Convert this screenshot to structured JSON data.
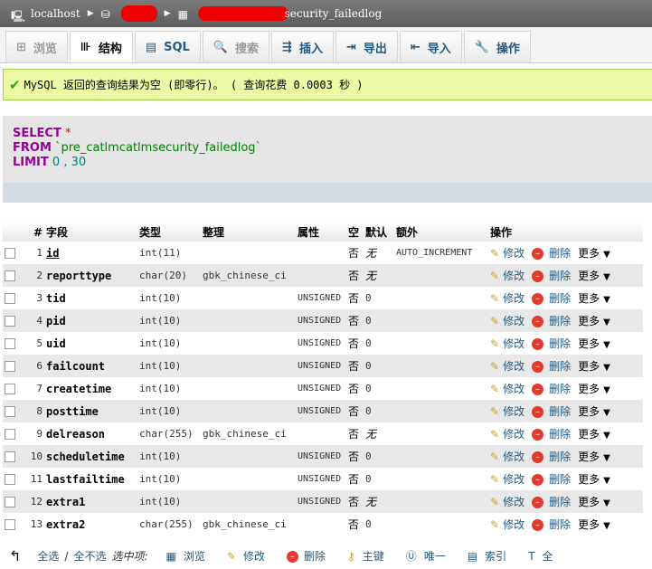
{
  "breadcrumb": {
    "server": "localhost",
    "table": "security_failedlog"
  },
  "tabs": [
    {
      "label": "浏览",
      "icon": "⊞"
    },
    {
      "label": "结构",
      "icon": "⊪"
    },
    {
      "label": "SQL",
      "icon": "▤"
    },
    {
      "label": "搜索",
      "icon": "🔍"
    },
    {
      "label": "插入",
      "icon": "⇶"
    },
    {
      "label": "导出",
      "icon": "⇥"
    },
    {
      "label": "导入",
      "icon": "⇤"
    },
    {
      "label": "操作",
      "icon": "🔧"
    }
  ],
  "message": {
    "text": "MySQL 返回的查询结果为空 (即零行)。 ( 查询花费 0.0003 秒 )"
  },
  "sql": {
    "select": "SELECT",
    "star": "*",
    "from": "FROM",
    "table": "`pre_catlmcatlmsecurity_failedlog`",
    "limit": "LIMIT",
    "offset": "0",
    "comma": " , ",
    "count": "30"
  },
  "columns": [
    "#",
    "字段",
    "类型",
    "整理",
    "属性",
    "空",
    "默认",
    "额外",
    "操作"
  ],
  "rows": [
    {
      "n": "1",
      "name": "id",
      "type": "int(11)",
      "coll": "",
      "attr": "",
      "null": "否",
      "def": "无",
      "extra": "AUTO_INCREMENT"
    },
    {
      "n": "2",
      "name": "reporttype",
      "type": "char(20)",
      "coll": "gbk_chinese_ci",
      "attr": "",
      "null": "否",
      "def": "无",
      "extra": ""
    },
    {
      "n": "3",
      "name": "tid",
      "type": "int(10)",
      "coll": "",
      "attr": "UNSIGNED",
      "null": "否",
      "def": "0",
      "extra": ""
    },
    {
      "n": "4",
      "name": "pid",
      "type": "int(10)",
      "coll": "",
      "attr": "UNSIGNED",
      "null": "否",
      "def": "0",
      "extra": ""
    },
    {
      "n": "5",
      "name": "uid",
      "type": "int(10)",
      "coll": "",
      "attr": "UNSIGNED",
      "null": "否",
      "def": "0",
      "extra": ""
    },
    {
      "n": "6",
      "name": "failcount",
      "type": "int(10)",
      "coll": "",
      "attr": "UNSIGNED",
      "null": "否",
      "def": "0",
      "extra": ""
    },
    {
      "n": "7",
      "name": "createtime",
      "type": "int(10)",
      "coll": "",
      "attr": "UNSIGNED",
      "null": "否",
      "def": "0",
      "extra": ""
    },
    {
      "n": "8",
      "name": "posttime",
      "type": "int(10)",
      "coll": "",
      "attr": "UNSIGNED",
      "null": "否",
      "def": "0",
      "extra": ""
    },
    {
      "n": "9",
      "name": "delreason",
      "type": "char(255)",
      "coll": "gbk_chinese_ci",
      "attr": "",
      "null": "否",
      "def": "无",
      "extra": ""
    },
    {
      "n": "10",
      "name": "scheduletime",
      "type": "int(10)",
      "coll": "",
      "attr": "UNSIGNED",
      "null": "否",
      "def": "0",
      "extra": ""
    },
    {
      "n": "11",
      "name": "lastfailtime",
      "type": "int(10)",
      "coll": "",
      "attr": "UNSIGNED",
      "null": "否",
      "def": "0",
      "extra": ""
    },
    {
      "n": "12",
      "name": "extra1",
      "type": "int(10)",
      "coll": "",
      "attr": "UNSIGNED",
      "null": "否",
      "def": "无",
      "extra": ""
    },
    {
      "n": "13",
      "name": "extra2",
      "type": "char(255)",
      "coll": "gbk_chinese_ci",
      "attr": "",
      "null": "否",
      "def": "0",
      "extra": ""
    }
  ],
  "row_actions": {
    "edit": "修改",
    "delete": "删除",
    "more": "更多"
  },
  "footer": {
    "select_all": "全选",
    "slash": "/",
    "deselect_all": "全不选",
    "selected_label": "选中项:",
    "actions": [
      "浏览",
      "修改",
      "删除",
      "主键",
      "唯一",
      "索引",
      "全"
    ]
  }
}
